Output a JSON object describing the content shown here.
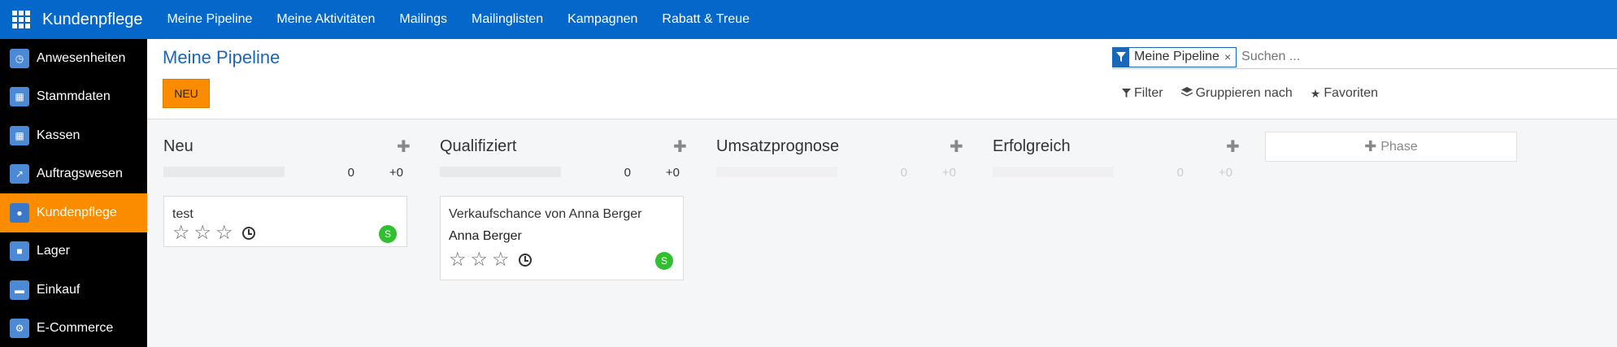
{
  "topbar": {
    "brand": "Kundenpflege",
    "nav": [
      "Meine Pipeline",
      "Meine Aktivitäten",
      "Mailings",
      "Mailinglisten",
      "Kampagnen",
      "Rabatt & Treue"
    ]
  },
  "sidebar": {
    "items": [
      {
        "label": "Anwesenheiten",
        "icon": "calendar-icon",
        "active": false
      },
      {
        "label": "Stammdaten",
        "icon": "data-icon",
        "active": false
      },
      {
        "label": "Kassen",
        "icon": "grid-icon",
        "active": false
      },
      {
        "label": "Auftragswesen",
        "icon": "chart-icon",
        "active": false
      },
      {
        "label": "Kundenpflege",
        "icon": "users-icon",
        "active": true
      },
      {
        "label": "Lager",
        "icon": "box-icon",
        "active": false
      },
      {
        "label": "Einkauf",
        "icon": "card-icon",
        "active": false
      },
      {
        "label": "E-Commerce",
        "icon": "cart-icon",
        "active": false
      }
    ]
  },
  "control": {
    "title": "Meine Pipeline",
    "new_button": "NEU",
    "search": {
      "facet": "Meine Pipeline",
      "placeholder": "Suchen ..."
    },
    "filters": {
      "filter": "Filter",
      "group_by": "Gruppieren nach",
      "favorites": "Favoriten"
    }
  },
  "kanban": {
    "columns": [
      {
        "title": "Neu",
        "count": "0",
        "sum": "+0",
        "faded": false
      },
      {
        "title": "Qualifiziert",
        "count": "0",
        "sum": "+0",
        "faded": false
      },
      {
        "title": "Umsatzprognose",
        "count": "0",
        "sum": "+0",
        "faded": true
      },
      {
        "title": "Erfolgreich",
        "count": "0",
        "sum": "+0",
        "faded": true
      }
    ],
    "cards": [
      {
        "title": "test",
        "subtitle": "",
        "avatar": "S"
      },
      {
        "title": "Verkaufschance von Anna Berger",
        "subtitle": "Anna Berger",
        "avatar": "S"
      }
    ],
    "add_phase": "Phase"
  },
  "colors": {
    "topbar": "#0567c9",
    "accent": "#fb8c00",
    "title": "#1a67b8",
    "avatar": "#2fbf2f"
  }
}
